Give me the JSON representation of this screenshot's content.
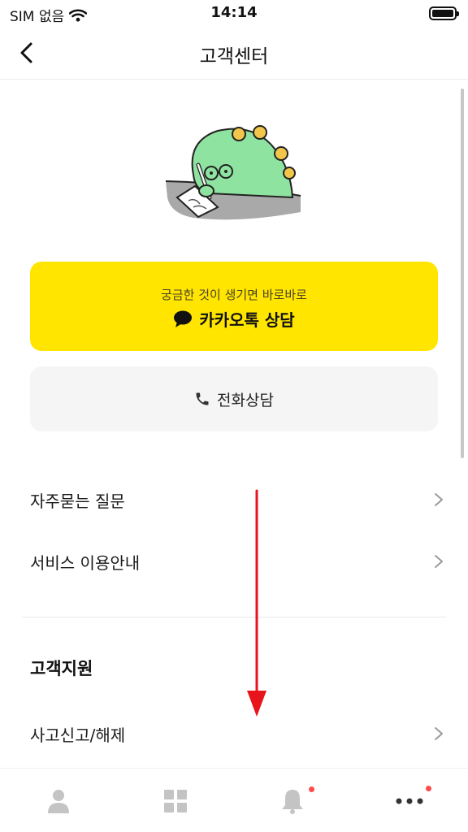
{
  "status_bar": {
    "carrier": "SIM 없음",
    "time": "14:14"
  },
  "nav": {
    "title": "고객센터"
  },
  "kakao": {
    "subtitle": "궁금한 것이 생기면 바로바로",
    "label": "카카오톡 상담"
  },
  "phone": {
    "label": "전화상담"
  },
  "menu": [
    {
      "label": "자주묻는 질문"
    },
    {
      "label": "서비스 이용안내"
    }
  ],
  "support": {
    "title": "고객지원",
    "items": [
      {
        "label": "사고신고/해제"
      }
    ]
  },
  "tabs": [
    {
      "icon": "person-icon",
      "badge": false
    },
    {
      "icon": "grid-icon",
      "badge": false
    },
    {
      "icon": "bell-icon",
      "badge": true
    },
    {
      "icon": "more-icon",
      "badge": true
    }
  ],
  "colors": {
    "kakao_yellow": "#ffe500",
    "badge_red": "#ff4b4b",
    "arrow_red": "#e8141b"
  }
}
